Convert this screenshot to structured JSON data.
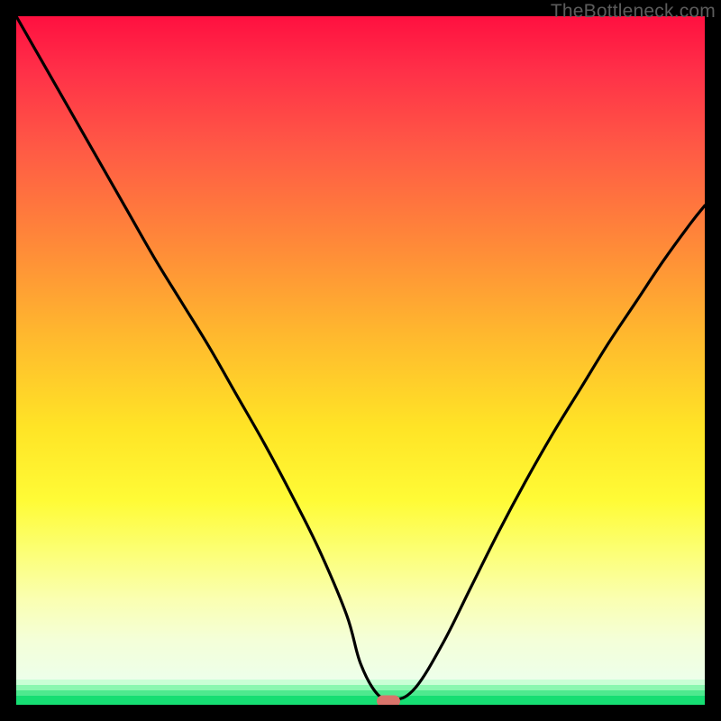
{
  "watermark": "TheBottleneck.com",
  "colors": {
    "frame": "#000000",
    "curve": "#000000",
    "marker": "#d9746b",
    "gradient_top": "#ff1040",
    "gradient_bottom": "#16de73"
  },
  "chart_data": {
    "type": "line",
    "title": "",
    "xlabel": "",
    "ylabel": "",
    "xlim": [
      0,
      100
    ],
    "ylim": [
      0,
      100
    ],
    "grid": false,
    "x": [
      0,
      4,
      8,
      12,
      16,
      20,
      24,
      28,
      32,
      36,
      40,
      44,
      48,
      50,
      52.5,
      55,
      58,
      62,
      66,
      70,
      74,
      78,
      82,
      86,
      90,
      94,
      98,
      100
    ],
    "values": [
      100,
      93,
      86,
      79,
      72,
      65,
      58.5,
      52,
      45,
      38,
      30.5,
      22.5,
      13,
      6,
      1.5,
      0.7,
      2.5,
      9,
      17,
      25,
      32.5,
      39.5,
      46,
      52.5,
      58.5,
      64.5,
      70,
      72.5
    ],
    "marker": {
      "x": 54,
      "y": 0.5
    },
    "flat_segment": {
      "xstart": 51,
      "xend": 56,
      "y": 0.7
    }
  }
}
